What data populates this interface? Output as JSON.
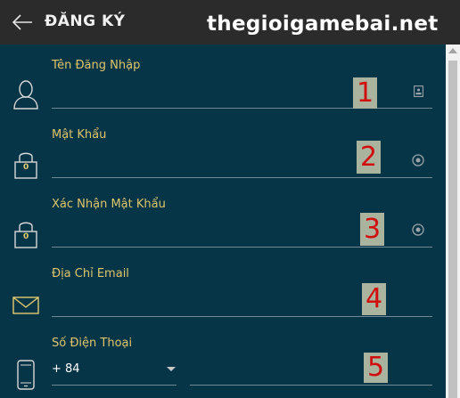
{
  "header": {
    "title": "ĐĂNG KÝ",
    "back_icon": "arrow-left-icon",
    "watermark": "thegioigamebai.net"
  },
  "form": {
    "fields": [
      {
        "label": "Tên Đăng Nhập",
        "icon": "user-icon",
        "trailing_icon": "id-card-icon",
        "value": "",
        "number_mark": "1"
      },
      {
        "label": "Mật Khẩu",
        "icon": "lock-icon",
        "lock_text": "0",
        "trailing_icon": "eye-icon",
        "value": "",
        "number_mark": "2"
      },
      {
        "label": "Xác Nhận Mật Khẩu",
        "icon": "lock-icon",
        "lock_text": "0",
        "trailing_icon": "eye-icon",
        "value": "",
        "number_mark": "3"
      },
      {
        "label": "Địa Chỉ Email",
        "icon": "mail-icon",
        "value": "",
        "number_mark": "4"
      },
      {
        "label": "Số Điện Thoại",
        "icon": "phone-icon",
        "country_code": "+ 84",
        "value": "",
        "number_mark": "5"
      }
    ]
  },
  "colors": {
    "background": "#073548",
    "header": "#2b2b2b",
    "label": "#dcc66a",
    "line": "#6f8a96",
    "icon": "#d8d8d8",
    "badge_bg": "#a9b39e",
    "badge_text": "#d10e0e"
  }
}
